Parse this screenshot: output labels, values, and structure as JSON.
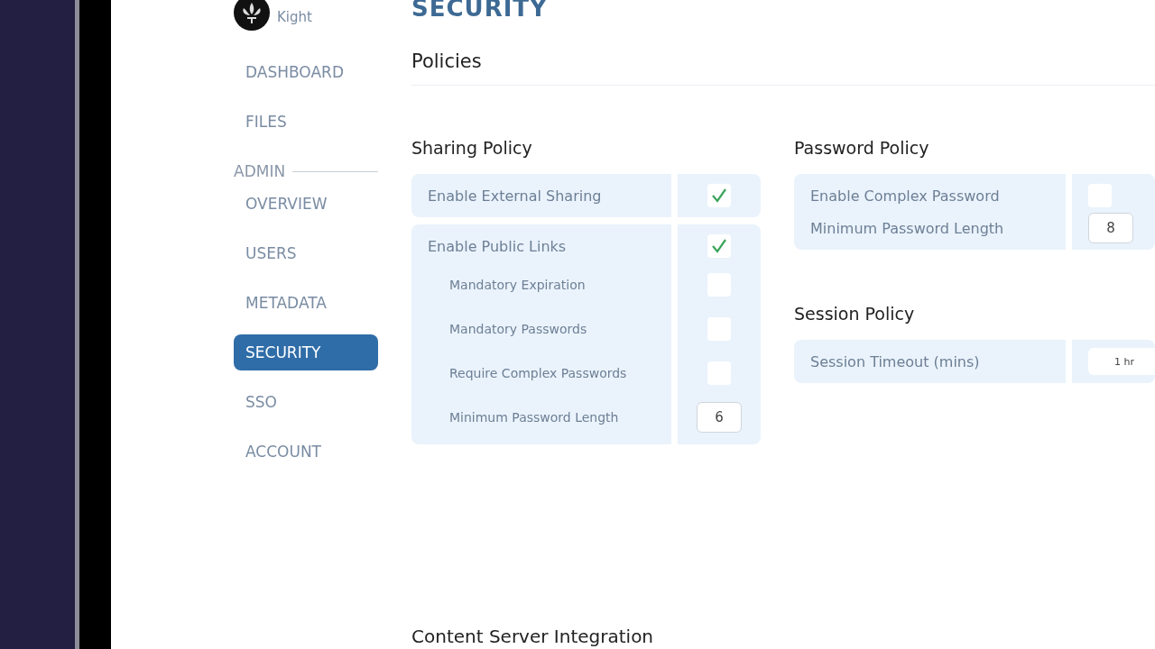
{
  "sidebar": {
    "user": {
      "name": "Kight"
    },
    "items": [
      {
        "label": "DASHBOARD",
        "selected": false
      },
      {
        "label": "FILES",
        "selected": false
      },
      {
        "kind": "section",
        "label": "ADMIN"
      },
      {
        "label": "OVERVIEW",
        "selected": false
      },
      {
        "label": "USERS",
        "selected": false
      },
      {
        "label": "METADATA",
        "selected": false
      },
      {
        "label": "SECURITY",
        "selected": true
      },
      {
        "label": "SSO",
        "selected": false
      },
      {
        "label": "ACCOUNT",
        "selected": false
      }
    ]
  },
  "page": {
    "title": "SECURITY",
    "subtitle": "Policies"
  },
  "columns": [
    {
      "sections": [
        {
          "title": "Sharing Policy",
          "groups": [
            [
              {
                "label": "Enable External Sharing",
                "kind": "checkbox",
                "checked": true
              }
            ],
            [
              {
                "label": "Enable Public Links",
                "kind": "checkbox",
                "checked": true,
                "children": [
                  {
                    "label": "Mandatory Expiration",
                    "kind": "checkbox",
                    "checked": false
                  },
                  {
                    "label": "Mandatory Passwords",
                    "kind": "checkbox",
                    "checked": false
                  },
                  {
                    "label": "Require Complex Passwords",
                    "kind": "checkbox",
                    "checked": false
                  },
                  {
                    "label": "Minimum Password Length",
                    "kind": "number",
                    "value": "6"
                  }
                ]
              }
            ]
          ]
        }
      ]
    },
    {
      "sections": [
        {
          "title": "Password Policy",
          "groups": [
            [
              {
                "label": "Enable Complex Password",
                "kind": "checkbox",
                "checked": false
              },
              {
                "label": "Minimum Password Length",
                "kind": "number",
                "value": "8"
              }
            ]
          ]
        },
        {
          "title": "Session Policy",
          "groups": [
            [
              {
                "label": "Session Timeout (mins)",
                "kind": "select",
                "value": "1 hr"
              }
            ]
          ]
        }
      ]
    }
  ],
  "footer_section": {
    "title": "Content Server Integration"
  }
}
